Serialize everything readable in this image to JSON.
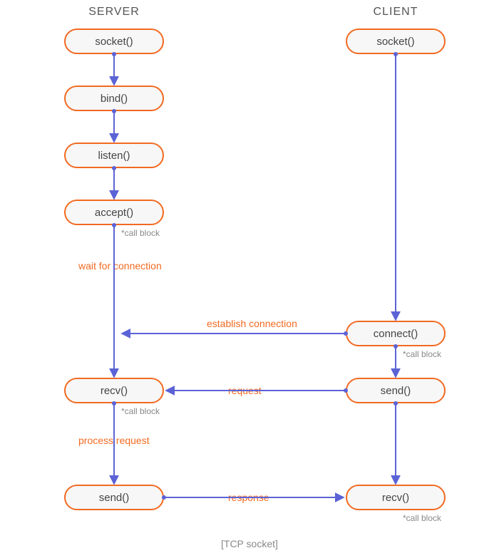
{
  "diagram": {
    "caption": "[TCP socket]",
    "call_block": "*call block"
  },
  "columns": {
    "server": "SERVER",
    "client": "CLIENT"
  },
  "server_nodes": {
    "socket": "socket()",
    "bind": "bind()",
    "listen": "listen()",
    "accept": "accept()",
    "recv": "recv()",
    "send": "send()"
  },
  "client_nodes": {
    "socket": "socket()",
    "connect": "connect()",
    "send": "send()",
    "recv": "recv()"
  },
  "labels": {
    "wait_for_connection": "wait for connection",
    "establish_connection": "establish connection",
    "request": "request",
    "process_request": "process request",
    "response": "response"
  },
  "colors": {
    "node_border": "#f26a21",
    "node_fill": "#f7f7f7",
    "arrow": "#5b63d6",
    "label": "#f26a21",
    "annot": "#888888"
  },
  "chart_data": {
    "type": "diagram",
    "title": "[TCP socket]",
    "nodes": [
      {
        "id": "s_socket",
        "column": "server",
        "label": "socket()"
      },
      {
        "id": "s_bind",
        "column": "server",
        "label": "bind()"
      },
      {
        "id": "s_listen",
        "column": "server",
        "label": "listen()"
      },
      {
        "id": "s_accept",
        "column": "server",
        "label": "accept()",
        "note": "*call block"
      },
      {
        "id": "s_recv",
        "column": "server",
        "label": "recv()",
        "note": "*call block"
      },
      {
        "id": "s_send",
        "column": "server",
        "label": "send()"
      },
      {
        "id": "c_socket",
        "column": "client",
        "label": "socket()"
      },
      {
        "id": "c_connect",
        "column": "client",
        "label": "connect()",
        "note": "*call block"
      },
      {
        "id": "c_send",
        "column": "client",
        "label": "send()"
      },
      {
        "id": "c_recv",
        "column": "client",
        "label": "recv()",
        "note": "*call block"
      }
    ],
    "edges": [
      {
        "from": "s_socket",
        "to": "s_bind"
      },
      {
        "from": "s_bind",
        "to": "s_listen"
      },
      {
        "from": "s_listen",
        "to": "s_accept"
      },
      {
        "from": "s_accept",
        "to": "s_recv",
        "label": "wait for connection"
      },
      {
        "from": "s_recv",
        "to": "s_send",
        "label": "process request"
      },
      {
        "from": "c_socket",
        "to": "c_connect"
      },
      {
        "from": "c_connect",
        "to": "c_send"
      },
      {
        "from": "c_send",
        "to": "c_recv"
      },
      {
        "from": "c_connect",
        "to": "s_accept",
        "label": "establish connection",
        "direction": "left"
      },
      {
        "from": "c_send",
        "to": "s_recv",
        "label": "request",
        "direction": "left"
      },
      {
        "from": "s_send",
        "to": "c_recv",
        "label": "response",
        "direction": "right"
      }
    ]
  }
}
